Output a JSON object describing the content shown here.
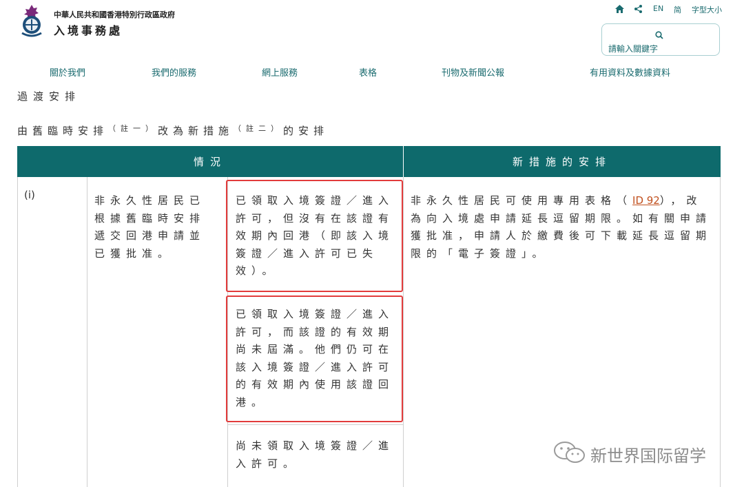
{
  "header": {
    "gov_name": "中華人民共和國香港特別行政區政府",
    "dept_name": "入境事務處",
    "utility": {
      "home_icon": "home-icon",
      "share_icon": "share-icon",
      "lang_en": "EN",
      "lang_simplified": "简",
      "font_size": "字型大小"
    },
    "search": {
      "placeholder": "請輸入關鍵字",
      "icon": "search-icon"
    }
  },
  "nav": {
    "items": [
      {
        "label": "關於我們"
      },
      {
        "label": "我們的服務"
      },
      {
        "label": "網上服務"
      },
      {
        "label": "表格"
      },
      {
        "label": "刊物及新聞公報"
      },
      {
        "label": "有用資料及數據資料"
      }
    ]
  },
  "page": {
    "title": "過渡安排",
    "subtitle_parts": [
      "由舊臨時安排",
      "（註一）",
      "改為新措施",
      "（註二）",
      "的安排"
    ]
  },
  "table": {
    "headers": {
      "situation": "情況",
      "arrangement": "新措施的安排"
    },
    "row": {
      "index": "(i)",
      "condition": "非永久性居民已根據舊臨時安排遞交回港申請並已獲批准。",
      "sub_cases": [
        "已領取入境簽證／進入許可，但沒有在該證有效期內回港（即該入境簽證／進入許可已失效）。",
        "已領取入境簽證／進入許可，而該證的有效期尚未屆滿。他們仍可在該入境簽證／進入許可的有效期內使用該證回港。",
        "尚未領取入境簽證／進入許可。"
      ],
      "arrangement_before": "非永久性居民可使用專用表格（",
      "arrangement_link": "ID 92",
      "arrangement_after": "），改為向入境處申請延長逗留期限。如有關申請獲批准，申請人於繳費後可下載延長逗留期限的「電子簽證」。"
    }
  },
  "watermark": {
    "text": "新世界国际留学"
  },
  "colors": {
    "header_bg": "#0e6a6c",
    "accent": "#1a6b6f",
    "highlight_border": "#e23b3b",
    "link": "#c1501e"
  }
}
